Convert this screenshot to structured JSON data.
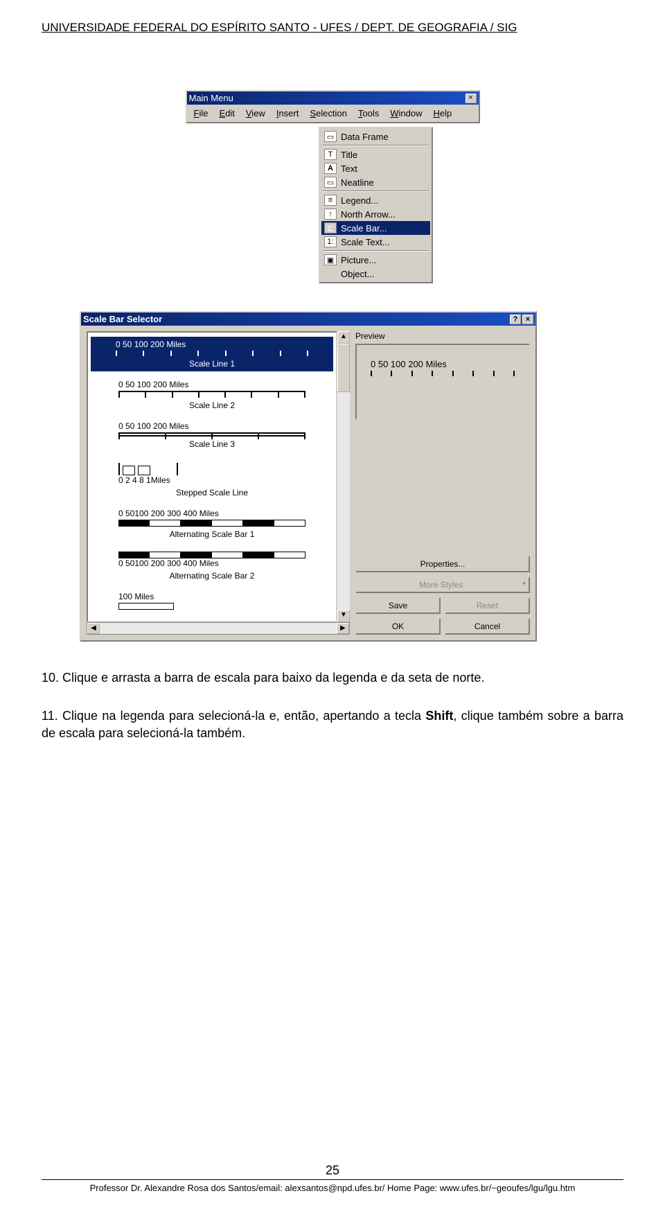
{
  "header": "UNIVERSIDADE FEDERAL DO ESPÍRITO SANTO - UFES / DEPT. DE GEOGRAFIA / SIG",
  "mainmenu": {
    "title": "Main Menu",
    "close": "×",
    "items": [
      "File",
      "Edit",
      "View",
      "Insert",
      "Selection",
      "Tools",
      "Window",
      "Help"
    ]
  },
  "insertmenu": {
    "items": [
      {
        "icon": "df",
        "label": "Data Frame"
      },
      {
        "icon": "t",
        "label": "Title"
      },
      {
        "icon": "A",
        "label": "Text"
      },
      {
        "icon": "n",
        "label": "Neatline"
      },
      {
        "icon": "leg",
        "label": "Legend..."
      },
      {
        "icon": "na",
        "label": "North Arrow..."
      },
      {
        "icon": "sb",
        "label": "Scale Bar...",
        "hl": true
      },
      {
        "icon": "st",
        "label": "Scale Text..."
      },
      {
        "icon": "pic",
        "label": "Picture..."
      },
      {
        "icon": "",
        "label": "Object..."
      }
    ]
  },
  "selector": {
    "title": "Scale Bar Selector",
    "help": "?",
    "close": "×",
    "preview_label": "Preview",
    "preview_nums": "0   50 100        200 Miles",
    "styles": [
      {
        "nums": "0   50 100        200 Miles",
        "label": "Scale Line 1",
        "sel": true,
        "type": "ticks"
      },
      {
        "nums": "0   50 100        200 Miles",
        "label": "Scale Line 2",
        "type": "ticks"
      },
      {
        "nums": "0   50 100        200 Miles",
        "label": "Scale Line 3",
        "type": "ticks"
      },
      {
        "nums": "0   2   4          8        1Miles",
        "label": "Stepped Scale Line",
        "type": "stepped"
      },
      {
        "nums": "0   50100    200    300    400 Miles",
        "label": "Alternating Scale Bar 1",
        "type": "alt"
      },
      {
        "nums": "0   50100    200    300    400 Miles",
        "label": "Alternating Scale Bar 2",
        "type": "alt"
      },
      {
        "nums": "100 Miles",
        "label": "",
        "type": "hollow"
      }
    ],
    "buttons": {
      "properties": "Properties...",
      "more": "More Styles",
      "save": "Save",
      "reset": "Reset",
      "ok": "OK",
      "cancel": "Cancel"
    }
  },
  "body": {
    "p1_num": "10. ",
    "p1": "Clique e arrasta a barra de escala para baixo da legenda e da seta de norte.",
    "p2_num": "11. ",
    "p2a": "Clique na legenda para selecioná-la e, então, apertando a tecla ",
    "p2_bold": "Shift",
    "p2b": ", clique também sobre a barra de escala para selecioná-la também."
  },
  "footer": {
    "pagenum": "25",
    "credit": "Professor Dr. Alexandre Rosa dos Santos/email: alexsantos@npd.ufes.br/ Home Page: www.ufes.br/~geoufes/lgu/lgu.htm"
  }
}
